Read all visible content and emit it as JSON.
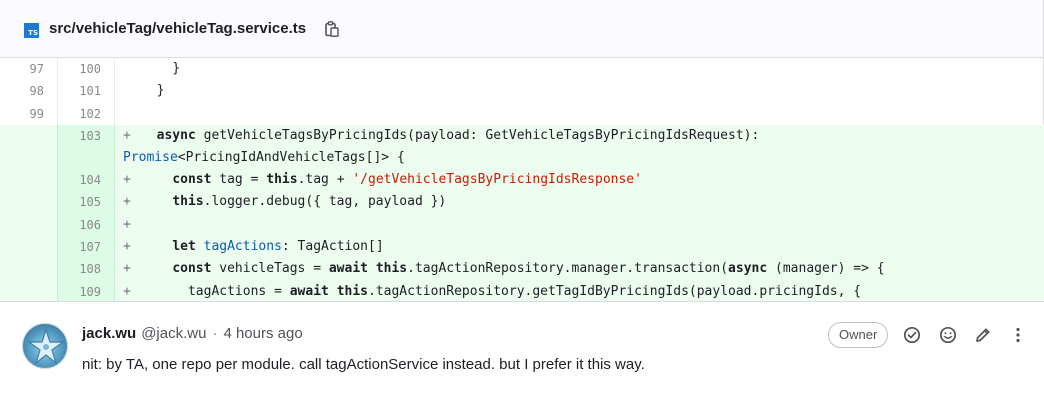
{
  "file": {
    "language_badge": "TS",
    "path": "src/vehicleTag/vehicleTag.service.ts"
  },
  "diff_lines": [
    {
      "old": "97",
      "new": "100",
      "sign": "",
      "text": "    }"
    },
    {
      "old": "98",
      "new": "101",
      "sign": "",
      "text": "  }"
    },
    {
      "old": "99",
      "new": "102",
      "sign": "",
      "text": ""
    },
    {
      "old": "",
      "new": "103",
      "sign": "+",
      "text": "  async getVehicleTagsByPricingIds(payload: GetVehicleTagsByPricingIdsRequest):"
    },
    {
      "old": "",
      "new": "",
      "sign": "",
      "text": "Promise<PricingIdAndVehicleTags[]> {"
    },
    {
      "old": "",
      "new": "104",
      "sign": "+",
      "text": "    const tag = this.tag + '/getVehicleTagsByPricingIdsResponse'"
    },
    {
      "old": "",
      "new": "105",
      "sign": "+",
      "text": "    this.logger.debug({ tag, payload })"
    },
    {
      "old": "",
      "new": "106",
      "sign": "+",
      "text": ""
    },
    {
      "old": "",
      "new": "107",
      "sign": "+",
      "text": "    let tagActions: TagAction[]"
    },
    {
      "old": "",
      "new": "108",
      "sign": "+",
      "text": "    const vehicleTags = await this.tagActionRepository.manager.transaction(async (manager) => {"
    },
    {
      "old": "",
      "new": "109",
      "sign": "+",
      "text": "      tagActions = await this.tagActionRepository.getTagIdByPricingIds(payload.pricingIds, {"
    }
  ],
  "comment": {
    "author_name": "jack.wu",
    "author_handle": "@jack.wu",
    "separator": "·",
    "time": "4 hours ago",
    "role_badge": "Owner",
    "body": "nit: by TA, one repo per module. call tagActionService instead. but I prefer it this way.",
    "actions": [
      "resolve-icon",
      "emoji-icon",
      "edit-icon",
      "more-icon"
    ]
  }
}
